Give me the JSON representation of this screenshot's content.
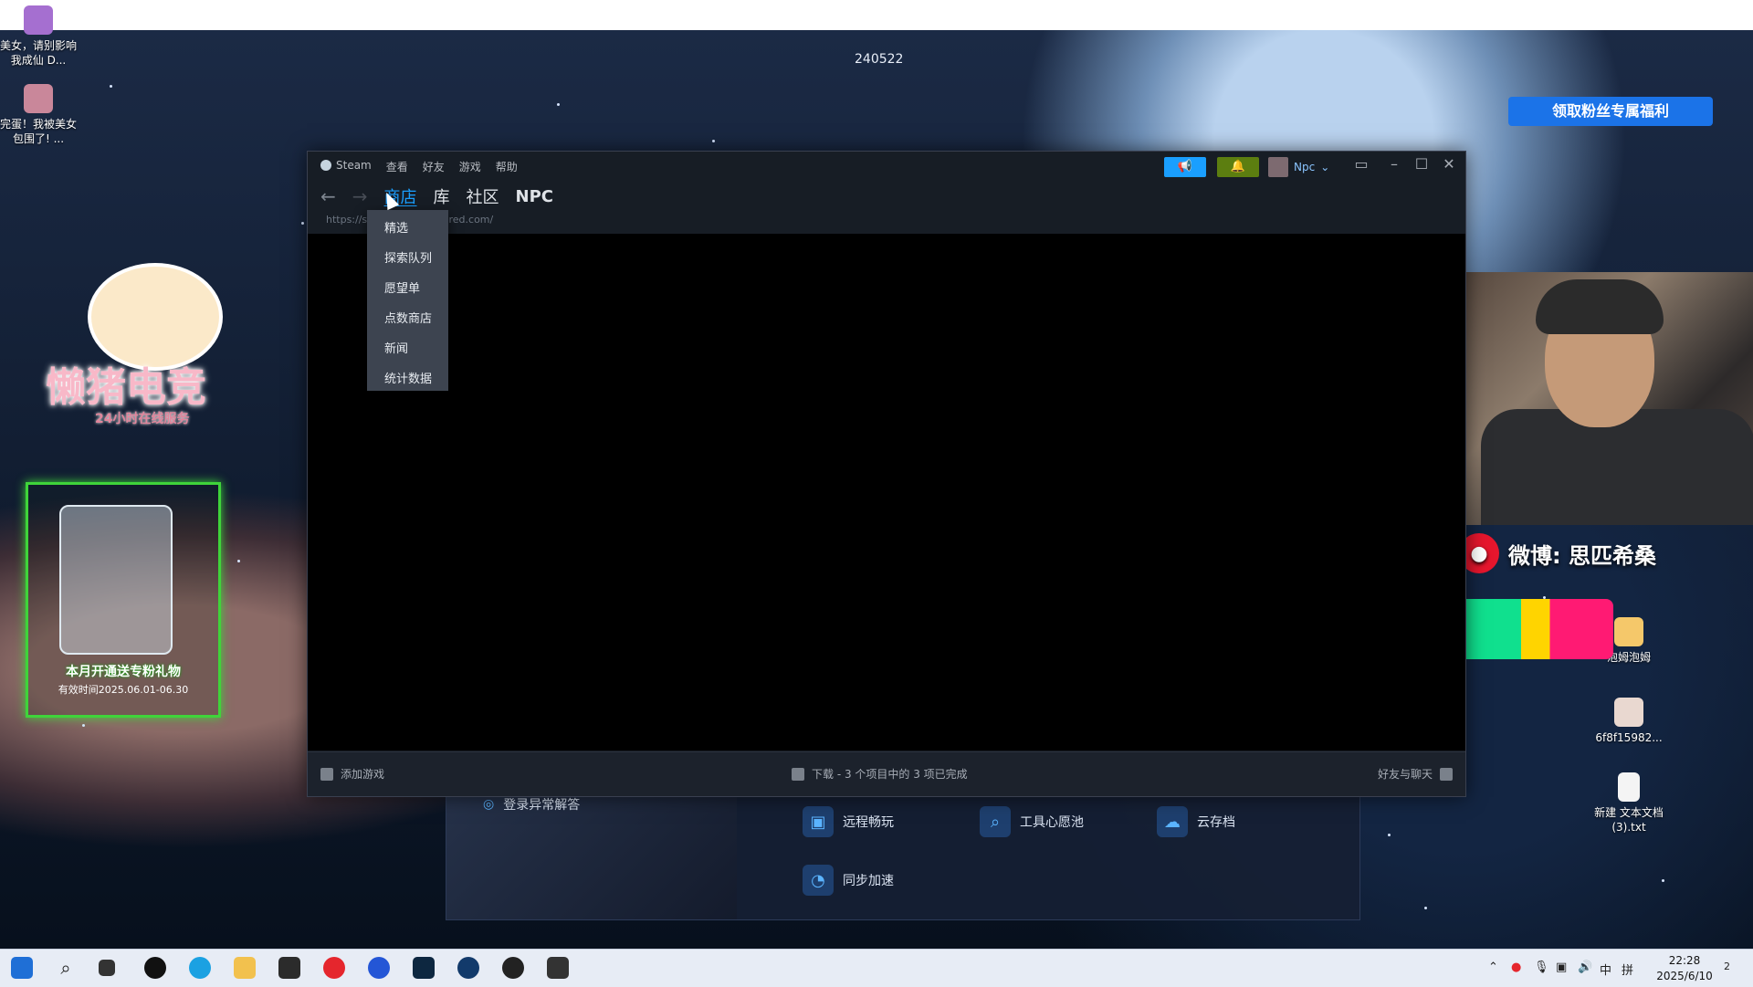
{
  "desktop": {
    "top_number": "240522",
    "icons": [
      {
        "label": "美女，请别影响我成仙 D..."
      },
      {
        "label": "完蛋！我被美女包围了! ..."
      },
      {
        "label": "泡姆泡姆"
      },
      {
        "label": "6f8f15982..."
      },
      {
        "label": "新建 文本文档 (3).txt"
      }
    ],
    "banner_button": "领取粉丝专属福利",
    "weibo_text": "微博: 思匹希桑",
    "mascot": {
      "title": "懒猪电竞",
      "subtitle": "24小时在线服务"
    },
    "beer_banner": {
      "caption": "本月开通送专粉礼物",
      "date": "有效时间2025.06.01-06.30"
    }
  },
  "steam": {
    "menu": [
      "Steam",
      "查看",
      "好友",
      "游戏",
      "帮助"
    ],
    "user": "Npc",
    "nav_tabs": [
      "商店",
      "库",
      "社区",
      "NPC"
    ],
    "url": "https://store.steampowered.com/",
    "store_menu": [
      "精选",
      "探索队列",
      "愿望单",
      "点数商店",
      "新闻",
      "统计数据"
    ],
    "bottom": {
      "add_game": "添加游戏",
      "downloads": "下载 - 3 个项目中的 3 项已完成",
      "friends": "好友与聊天"
    }
  },
  "accelerator": {
    "login_help": "登录异常解答",
    "features": [
      "远程畅玩",
      "工具心愿池",
      "云存档",
      "同步加速"
    ]
  },
  "taskbar": {
    "ime": "中",
    "ime2": "拼",
    "time": "22:28",
    "date": "2025/6/10",
    "notifications": "2"
  },
  "colors": {
    "steam_blue": "#1a9fff",
    "banner_blue": "#1b73e8",
    "weibo_red": "#e6162d"
  }
}
